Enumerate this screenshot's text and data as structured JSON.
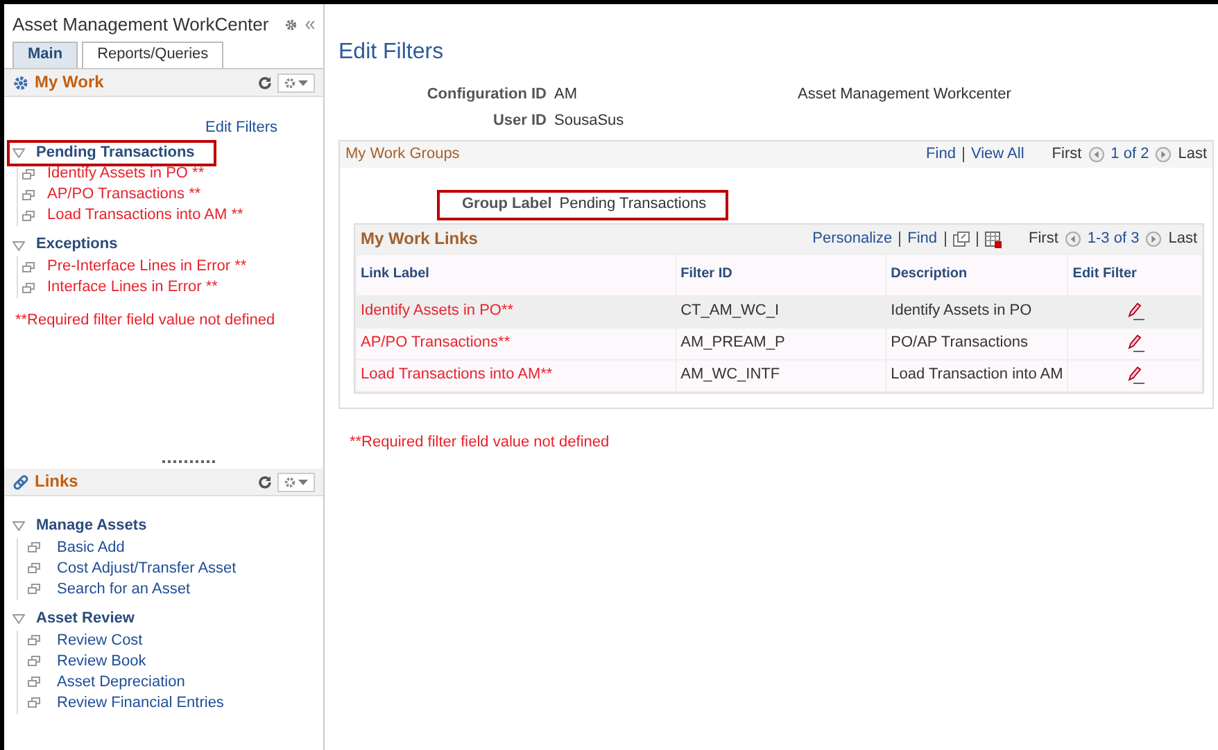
{
  "sidebar": {
    "title": "Asset Management WorkCenter",
    "tabs": [
      {
        "label": "Main",
        "selected": true
      },
      {
        "label": "Reports/Queries",
        "selected": false
      }
    ],
    "my_work": {
      "title": "My Work",
      "edit_filters": "Edit Filters",
      "note": "**Required filter field value not defined",
      "groups": [
        {
          "label": "Pending Transactions",
          "expanded": true,
          "highlighted": true,
          "items": [
            "Identify Assets in PO **",
            "AP/PO Transactions **",
            "Load Transactions into AM **"
          ]
        },
        {
          "label": "Exceptions",
          "expanded": true,
          "items": [
            "Pre-Interface Lines in Error **",
            "Interface Lines in Error **"
          ]
        }
      ]
    },
    "links": {
      "title": "Links",
      "groups": [
        {
          "label": "Manage Assets",
          "expanded": true,
          "items": [
            "Basic Add",
            "Cost Adjust/Transfer Asset",
            "Search for an Asset"
          ]
        },
        {
          "label": "Asset Review",
          "expanded": true,
          "items": [
            "Review Cost",
            "Review Book",
            "Asset Depreciation",
            "Review Financial Entries"
          ]
        }
      ]
    }
  },
  "main": {
    "title": "Edit Filters",
    "fields": [
      {
        "label": "Configuration ID",
        "value": "AM",
        "description": "Asset Management Workcenter"
      },
      {
        "label": "User ID",
        "value": "SousaSus"
      }
    ],
    "work_groups": {
      "title": "My Work Groups",
      "find": "Find",
      "view_all": "View All",
      "first": "First",
      "count": "1 of 2",
      "last": "Last",
      "group_label": {
        "label": "Group Label",
        "value": "Pending Transactions",
        "highlighted": true
      },
      "grid": {
        "title": "My Work Links",
        "personalize": "Personalize",
        "find": "Find",
        "first": "First",
        "count": "1-3 of 3",
        "last": "Last",
        "columns": [
          "Link Label",
          "Filter ID",
          "Description",
          "Edit Filter"
        ],
        "rows": [
          {
            "link_label": "Identify Assets in PO**",
            "filter_id": "CT_AM_WC_I",
            "description": "Identify Assets in PO",
            "selected": true
          },
          {
            "link_label": "AP/PO Transactions**",
            "filter_id": "AM_PREAM_P",
            "description": "PO/AP Transactions",
            "selected": false
          },
          {
            "link_label": "Load Transactions into AM**",
            "filter_id": "AM_WC_INTF",
            "description": "Load Transaction into AM",
            "selected": false
          }
        ]
      }
    },
    "note": "**Required filter field value not defined"
  }
}
